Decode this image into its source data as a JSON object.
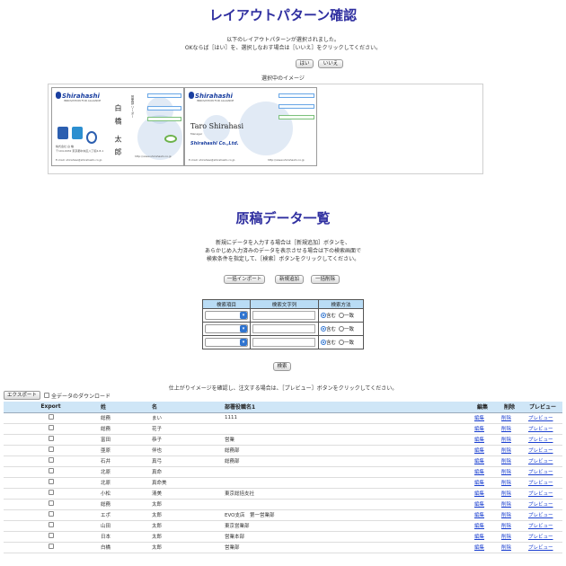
{
  "layout_confirm": {
    "title": "レイアウトパターン確認",
    "message_line1": "以下のレイアウトパターンが選択されました。",
    "message_line2": "OKならば［はい］を、選択しなおす場合は［いいえ］をクリックしてください。",
    "yes_label": "はい",
    "no_label": "いいえ",
    "preview_label": "選択中のイメージ"
  },
  "card_jp": {
    "logo": "Shirahashi",
    "tagline": "INNOVATION FOR ALLIANCE",
    "name": "白 橋　太 郎",
    "position": "営業部 リーダー",
    "company_line": "株式会社 白 橋",
    "contact": "〒104-0032 東京都中央区八丁堀4-8-1",
    "email": "E-mail: shirahasi@shirahashi.co.jp",
    "url": "http://www.shirahashi.co.jp"
  },
  "card_en": {
    "logo": "Shirahashi",
    "tagline": "INNOVATION FOR ALLIANCE",
    "name": "Taro Shirahasi",
    "position": "Manager",
    "company": "Shirahashi Co.,Ltd.",
    "email": "E-mail: shirahasi@shirahashi.co.jp",
    "url": "http://www.shirahashi.co.jp"
  },
  "manuscript": {
    "title": "原稿データ一覧",
    "message_line1": "新規にデータを入力する場合は［新規追加］ボタンを、",
    "message_line2": "あらかじめ入力済みのデータを表示させる場合は下の検索画面で",
    "message_line3": "検索条件を指定して、［検索］ボタンをクリックしてください。",
    "bulk_import_label": "一括インポート",
    "new_add_label": "新規追加",
    "bulk_delete_label": "一括削除"
  },
  "search": {
    "headers": [
      "検索項目",
      "検索文字列",
      "検索方法"
    ],
    "radio_include": "含む",
    "radio_match": "一致",
    "search_label": "検索"
  },
  "results": {
    "instruction": "仕上がりイメージを確認し、注文する場合は、［プレビュー］ボタンをクリックしてください。",
    "export_label": "エクスポート",
    "all_data_download_label": "全データのダウンロード",
    "headers": [
      "Export",
      "姓",
      "名",
      "部署役職名1",
      "編集",
      "削除",
      "プレビュー"
    ],
    "rows": [
      {
        "last": "総務",
        "first": "まい",
        "dept": "1111"
      },
      {
        "last": "総務",
        "first": "花子",
        "dept": ""
      },
      {
        "last": "富田",
        "first": "恭子",
        "dept": "営業"
      },
      {
        "last": "亜原",
        "first": "伴也",
        "dept": "総務部"
      },
      {
        "last": "石井",
        "first": "真弓",
        "dept": "総務部"
      },
      {
        "last": "北原",
        "first": "真命",
        "dept": ""
      },
      {
        "last": "北原",
        "first": "真命美",
        "dept": ""
      },
      {
        "last": "小松",
        "first": "清美",
        "dept": "東京総括支社"
      },
      {
        "last": "総務",
        "first": "太郎",
        "dept": ""
      },
      {
        "last": "エポ",
        "first": "太郎",
        "dept": "EVO支店　第一営業部"
      },
      {
        "last": "山田",
        "first": "太郎",
        "dept": "東京営業部"
      },
      {
        "last": "日本",
        "first": "太郎",
        "dept": "営業本部"
      },
      {
        "last": "白橋",
        "first": "太郎",
        "dept": "営業部"
      }
    ],
    "edit_label": "編集",
    "delete_label": "削除",
    "preview_label": "プレビュー"
  }
}
